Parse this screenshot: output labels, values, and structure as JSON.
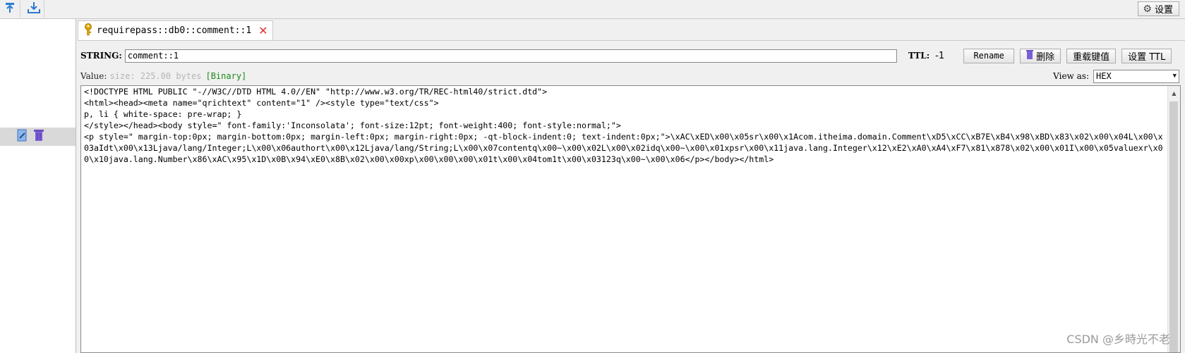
{
  "toolbar": {
    "settings_label": "设置"
  },
  "tab": {
    "title": "requirepass::db0::comment::1",
    "close_glyph": "✕"
  },
  "key": {
    "type_label": "STRING:",
    "name_value": "comment::1",
    "ttl_label": "TTL:",
    "ttl_value": "-1",
    "rename_label": "Rename",
    "delete_label": "删除",
    "reload_label": "重载键值",
    "set_ttl_label": "设置 TTL"
  },
  "value": {
    "label": "Value:",
    "size_text": "size: 225.00 bytes",
    "binary_badge": "[Binary]",
    "view_as_label": "View as:",
    "view_as_selected": "HEX",
    "content": "<!DOCTYPE HTML PUBLIC \"-//W3C//DTD HTML 4.0//EN\" \"http://www.w3.org/TR/REC-html40/strict.dtd\">\n<html><head><meta name=\"qrichtext\" content=\"1\" /><style type=\"text/css\">\np, li { white-space: pre-wrap; }\n</style></head><body style=\" font-family:'Inconsolata'; font-size:12pt; font-weight:400; font-style:normal;\">\n<p style=\" margin-top:0px; margin-bottom:0px; margin-left:0px; margin-right:0px; -qt-block-indent:0; text-indent:0px;\">\\xAC\\xED\\x00\\x05sr\\x00\\x1Acom.itheima.domain.Comment\\xD5\\xCC\\xB7E\\xB4\\x98\\xBD\\x83\\x02\\x00\\x04L\\x00\\x03aIdt\\x00\\x13Ljava/lang/Integer;L\\x00\\x06authort\\x00\\x12Ljava/lang/String;L\\x00\\x07contentq\\x00~\\x00\\x02L\\x00\\x02idq\\x00~\\x00\\x01xpsr\\x00\\x11java.lang.Integer\\x12\\xE2\\xA0\\xA4\\xF7\\x81\\x878\\x02\\x00\\x01I\\x00\\x05valuexr\\x00\\x10java.lang.Number\\x86\\xAC\\x95\\x1D\\x0B\\x94\\xE0\\x8B\\x02\\x00\\x00xp\\x00\\x00\\x00\\x01t\\x00\\x04tom1t\\x00\\x03123q\\x00~\\x00\\x06</p></body></html>"
  },
  "watermark": "CSDN @乡時光不老",
  "colors": {
    "key_icon": "#d4a017",
    "close": "#e03030",
    "binary": "#1a8a1a",
    "selected_row": "#d9d9d9"
  }
}
